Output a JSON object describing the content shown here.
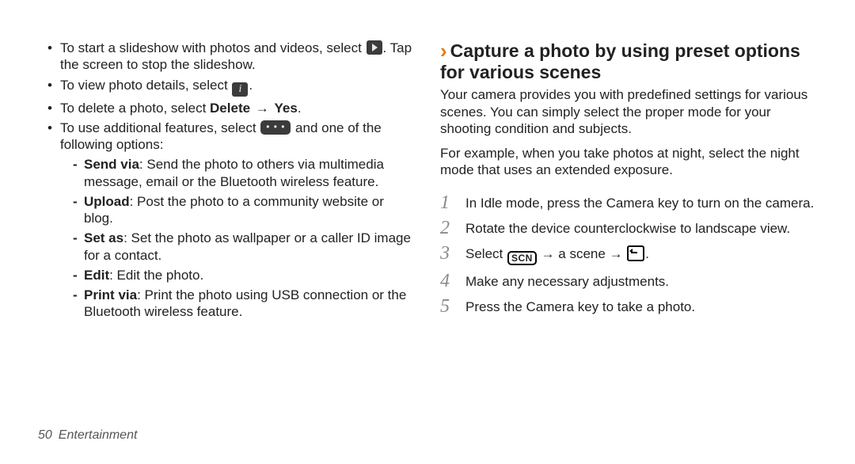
{
  "left": {
    "items": [
      {
        "pre": "To start a slideshow with photos and videos, select ",
        "icon": "play",
        "post": ". Tap the screen to stop the slideshow."
      },
      {
        "pre": "To view photo details, select ",
        "icon": "info",
        "post": "."
      },
      {
        "pre": "To delete a photo, select ",
        "bold1": "Delete",
        "arrow": " → ",
        "bold2": "Yes",
        "post2": "."
      },
      {
        "pre": "To use additional features, select ",
        "icon": "dots",
        "post": " and one of the following options:",
        "sub": [
          {
            "bold": "Send via",
            "rest": ": Send the photo to others via multimedia message, email or the Bluetooth wireless feature."
          },
          {
            "bold": "Upload",
            "rest": ": Post the photo to a community website or blog."
          },
          {
            "bold": "Set as",
            "rest": ": Set the photo as wallpaper or a caller ID image for a contact."
          },
          {
            "bold": "Edit",
            "rest": ": Edit the photo."
          },
          {
            "bold": "Print via",
            "rest": ": Print the photo using USB connection or the Bluetooth wireless feature."
          }
        ]
      }
    ]
  },
  "right": {
    "heading": "Capture a photo by using preset options for various scenes",
    "para1": "Your camera provides you with predefined settings for various scenes. You can simply select the proper mode for your shooting condition and subjects.",
    "para2": "For example, when you take photos at night, select the night mode that uses an extended exposure.",
    "steps": {
      "s1": "In Idle mode, press the Camera key to turn on the camera.",
      "s2": "Rotate the device counterclockwise to landscape view.",
      "s3_pre": "Select ",
      "s3_scn": "SCN",
      "s3_mid1": " → a scene → ",
      "s3_post": ".",
      "s4": "Make any necessary adjustments.",
      "s5": "Press the Camera key to take a photo."
    }
  },
  "footer": {
    "page": "50",
    "section": "Entertainment"
  }
}
